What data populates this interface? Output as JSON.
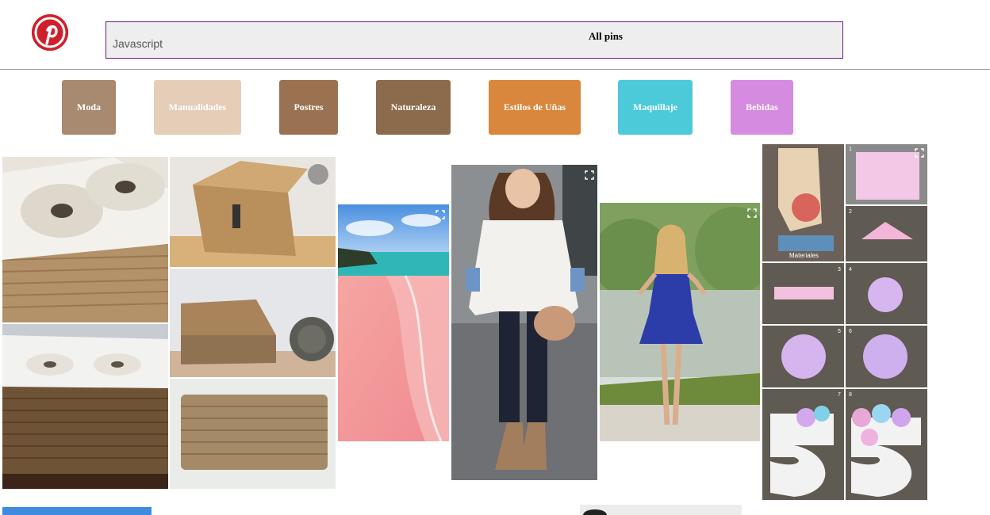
{
  "header": {
    "logo_icon": "pinterest-logo-icon",
    "search_value": "Javascript",
    "board_title": "All pins"
  },
  "categories": [
    {
      "label": "Moda",
      "color": "#a78a6f"
    },
    {
      "label": "Manualidades",
      "color": "#e5cdb8"
    },
    {
      "label": "Postres",
      "color": "#9b7251"
    },
    {
      "label": "Naturaleza",
      "color": "#8c6b4d"
    },
    {
      "label": "Estilos de Uñas",
      "color": "#d8873c"
    },
    {
      "label": "Maquillaje",
      "color": "#4ccad9"
    },
    {
      "label": "Bebidas",
      "color": "#d58be0"
    }
  ],
  "pins": [
    {
      "name": "rope-basket-diy"
    },
    {
      "name": "pink-beach"
    },
    {
      "name": "white-sweater-outfit"
    },
    {
      "name": "blue-dress"
    },
    {
      "name": "tissue-paper-number-five"
    }
  ],
  "collage_labels": {
    "materials": "Materiales",
    "steps": [
      "1",
      "2",
      "3",
      "4",
      "5",
      "6",
      "7",
      "8"
    ]
  }
}
